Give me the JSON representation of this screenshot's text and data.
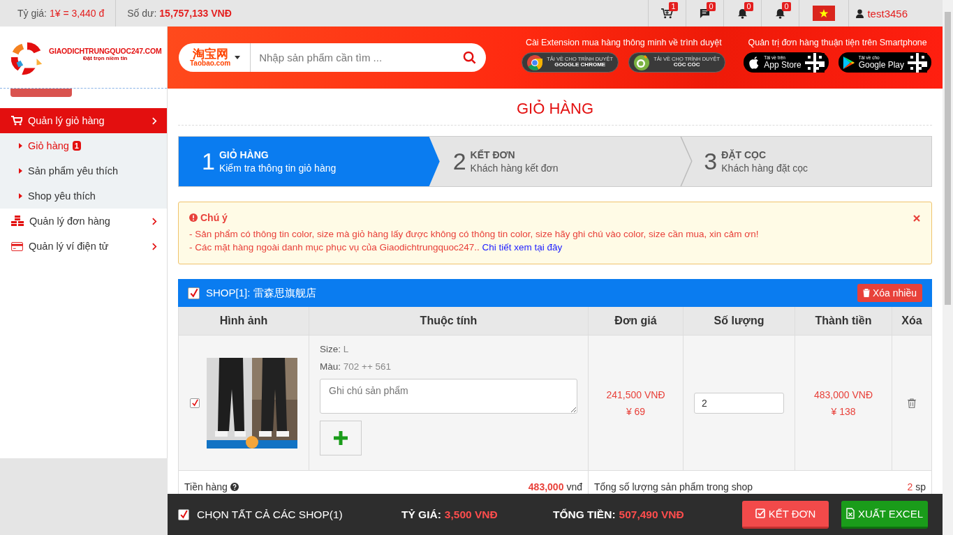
{
  "topbar": {
    "rate_label": "Tỷ giá:",
    "rate_value": "1¥ = 3,440 đ",
    "balance_label": "Số dư:",
    "balance_value": "15,757,133 VNĐ",
    "icons": [
      {
        "kind": "cart",
        "count": "1"
      },
      {
        "kind": "message",
        "count": "0"
      },
      {
        "kind": "bell",
        "count": "0"
      },
      {
        "kind": "bell",
        "count": "0"
      }
    ],
    "username": "test3456"
  },
  "logo": {
    "name": "GIAODICHTRUNGQUOC247.COM",
    "slogan": "Đặt trọn niềm tin"
  },
  "sidebar": {
    "items": [
      {
        "label": "Quản lý giỏ hàng",
        "kind": "cart",
        "selected": true,
        "expanded": true,
        "children": [
          {
            "label": "Giỏ hàng",
            "badge": "1",
            "selected": true
          },
          {
            "label": "Sản phẩm yêu thích",
            "selected": false
          },
          {
            "label": "Shop yêu thích",
            "selected": false
          }
        ]
      },
      {
        "label": "Quản lý đơn hàng",
        "kind": "boxes",
        "selected": false
      },
      {
        "label": "Quản lý ví điện tử",
        "kind": "card",
        "selected": false
      }
    ]
  },
  "search": {
    "site_name": "淘宝网",
    "site_domain": "Taobao.com",
    "placeholder": "Nhập sản phẩm cần tìm ..."
  },
  "promo": {
    "extension_title": "Cài Extension mua hàng thông minh về trình duyệt",
    "extension_buttons": [
      {
        "kind": "chrome",
        "line1": "TẢI VỀ CHO TRÌNH DUYỆT",
        "line2": "GOOGLE CHROME"
      },
      {
        "kind": "coccoc",
        "line1": "TẢI VỀ CHO TRÌNH DUYỆT",
        "line2": "CỐC CỐC"
      }
    ],
    "app_title": "Quản trị đơn hàng thuận tiện trên Smartphone",
    "app_buttons": [
      {
        "kind": "apple",
        "line1": "Tải về trên",
        "line2": "App Store"
      },
      {
        "kind": "google_play",
        "line1": "Tải về cho",
        "line2": "Google Play"
      }
    ]
  },
  "page_title": "GIỎ HÀNG",
  "steps": [
    {
      "number": "1",
      "title": "GIỎ HÀNG",
      "subtitle": "Kiểm tra thông tin giỏ hàng",
      "selected": true
    },
    {
      "number": "2",
      "title": "KẾT ĐƠN",
      "subtitle": "Khách hàng kết đơn",
      "selected": false
    },
    {
      "number": "3",
      "title": "ĐẶT CỌC",
      "subtitle": "Khách hàng đặt cọc",
      "selected": false
    }
  ],
  "notice": {
    "title": "Chú ý",
    "lines": [
      "- Sản phẩm có thông tin color, size mà giỏ hàng lấy được không có thông tin color, size hãy ghi chú vào color, size cần mua, xin cảm ơn!",
      "- Các mặt hàng ngoài danh mục phục vụ của Giaodichtrungquoc247.."
    ],
    "link": "Chi tiết xem tại đây"
  },
  "shop": {
    "checked": true,
    "name": "SHOP[1]: 雷森思旗舰店",
    "delete_button": "Xóa nhiều",
    "columns": [
      "Hình ảnh",
      "Thuộc tính",
      "Đơn giá",
      "Số lượng",
      "Thành tiền",
      "Xóa"
    ],
    "items": [
      {
        "checked": true,
        "size_label": "Size:",
        "size": "L",
        "variant_label": "Màu:",
        "variant": "702 ++ 561",
        "note_placeholder": "Ghi chú sản phẩm",
        "unit_price_vnd": "241,500 VNĐ",
        "unit_price_cny": "¥ 69",
        "quantity": "2",
        "total_vnd": "483,000 VNĐ",
        "total_cny": "¥ 138"
      }
    ],
    "summary_left": [
      {
        "label": "Tiền hàng",
        "help": true,
        "value": "483,000",
        "unit": "vnđ"
      }
    ],
    "summary_right": [
      {
        "kind": "total",
        "label": "Tổng số lượng sản phẩm trong shop",
        "value": "2",
        "unit": "sp"
      }
    ]
  },
  "bottom_bar": {
    "select_all_checked": true,
    "select_all_label": "CHỌN TẤT CẢ CÁC SHOP(1)",
    "rate_label": "TỶ GIÁ:",
    "rate_value": "3,500 VNĐ",
    "total_label": "TỔNG TIỀN:",
    "total_value": "507,490 VNĐ",
    "buttons": [
      {
        "kind": "order",
        "label": "KẾT ĐƠN"
      },
      {
        "kind": "excel",
        "label": "XUẤT EXCEL"
      }
    ]
  }
}
